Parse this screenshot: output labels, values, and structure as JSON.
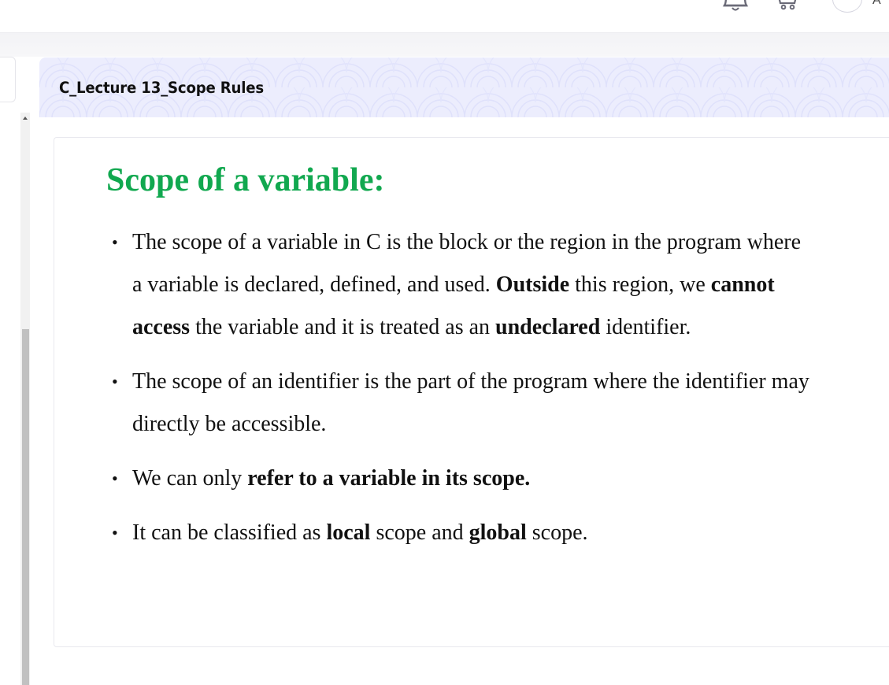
{
  "topbar": {
    "icons": [
      "bell-icon",
      "cart-icon",
      "avatar"
    ],
    "username_fragment": "A"
  },
  "lecture": {
    "title": "C_Lecture 13_Scope Rules",
    "header_bg": "#ecedfd"
  },
  "slide": {
    "heading": "Scope of a variable:",
    "heading_color": "#11a84f",
    "bullets": [
      {
        "parts": [
          {
            "text": "The scope of a variable in C is the block or the region in the program where a variable is declared, defined, and used. ",
            "bold": false
          },
          {
            "text": "Outside",
            "bold": true
          },
          {
            "text": " this region, we ",
            "bold": false
          },
          {
            "text": "cannot access",
            "bold": true
          },
          {
            "text": " the variable and it is treated as an ",
            "bold": false
          },
          {
            "text": "undeclared",
            "bold": true
          },
          {
            "text": " identifier.",
            "bold": false
          }
        ]
      },
      {
        "parts": [
          {
            "text": "The scope of an identifier is the part of the program where the identifier may directly be accessible.",
            "bold": false
          }
        ]
      },
      {
        "parts": [
          {
            "text": "We can only ",
            "bold": false
          },
          {
            "text": "refer to a variable in its scope.",
            "bold": true
          }
        ]
      },
      {
        "parts": [
          {
            "text": "It can be classified as ",
            "bold": false
          },
          {
            "text": "local",
            "bold": true
          },
          {
            "text": " scope and ",
            "bold": false
          },
          {
            "text": "global",
            "bold": true
          },
          {
            "text": " scope.",
            "bold": false
          }
        ]
      }
    ]
  }
}
